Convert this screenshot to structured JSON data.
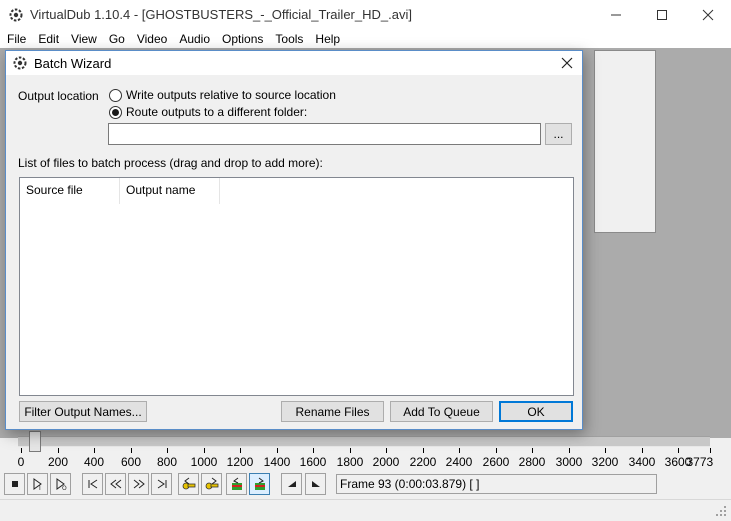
{
  "app": {
    "title": "VirtualDub 1.10.4 - [GHOSTBUSTERS_-_Official_Trailer_HD_.avi]",
    "menu": [
      "File",
      "Edit",
      "View",
      "Go",
      "Video",
      "Audio",
      "Options",
      "Tools",
      "Help"
    ],
    "window_controls": [
      "minimize-icon",
      "maximize-icon",
      "close-icon"
    ]
  },
  "dialog": {
    "title": "Batch Wizard",
    "output_location_label": "Output location",
    "radio_relative": {
      "label": "Write outputs relative to source location",
      "checked": false
    },
    "radio_route": {
      "label": "Route outputs to a different folder:",
      "checked": true
    },
    "folder_input": {
      "value": "",
      "placeholder": ""
    },
    "browse_label": "...",
    "files_label": "List of files to batch process (drag and drop to add more):",
    "columns": [
      "Source file",
      "Output name"
    ],
    "rows": [],
    "buttons": {
      "filter": "Filter Output Names...",
      "rename": "Rename Files",
      "add_queue": "Add To Queue",
      "ok": "OK"
    }
  },
  "timeline": {
    "ticks": [
      "0",
      "200",
      "400",
      "600",
      "800",
      "1000",
      "1200",
      "1400",
      "1600",
      "1800",
      "2000",
      "2200",
      "2400",
      "2600",
      "2800",
      "3000",
      "3200",
      "3400",
      "3600",
      "3773"
    ],
    "max_frame": 3773,
    "current_frame": 93
  },
  "toolbar": {
    "buttons": [
      "stop-icon",
      "play-input-icon",
      "play-output-icon",
      "go-start-icon",
      "prev-frame-icon",
      "next-frame-icon",
      "go-end-icon",
      "prev-keyframe-icon",
      "next-keyframe-icon",
      "scene-back-icon",
      "scene-forward-icon",
      "mark-in-icon",
      "mark-out-icon"
    ],
    "active_index": 10
  },
  "status": {
    "frame_text": "Frame 93 (0:00:03.879) [ ]"
  },
  "colors": {
    "accent": "#0078d7",
    "preview_bg": "#ababab",
    "dialog_border": "#5a8dc8"
  }
}
